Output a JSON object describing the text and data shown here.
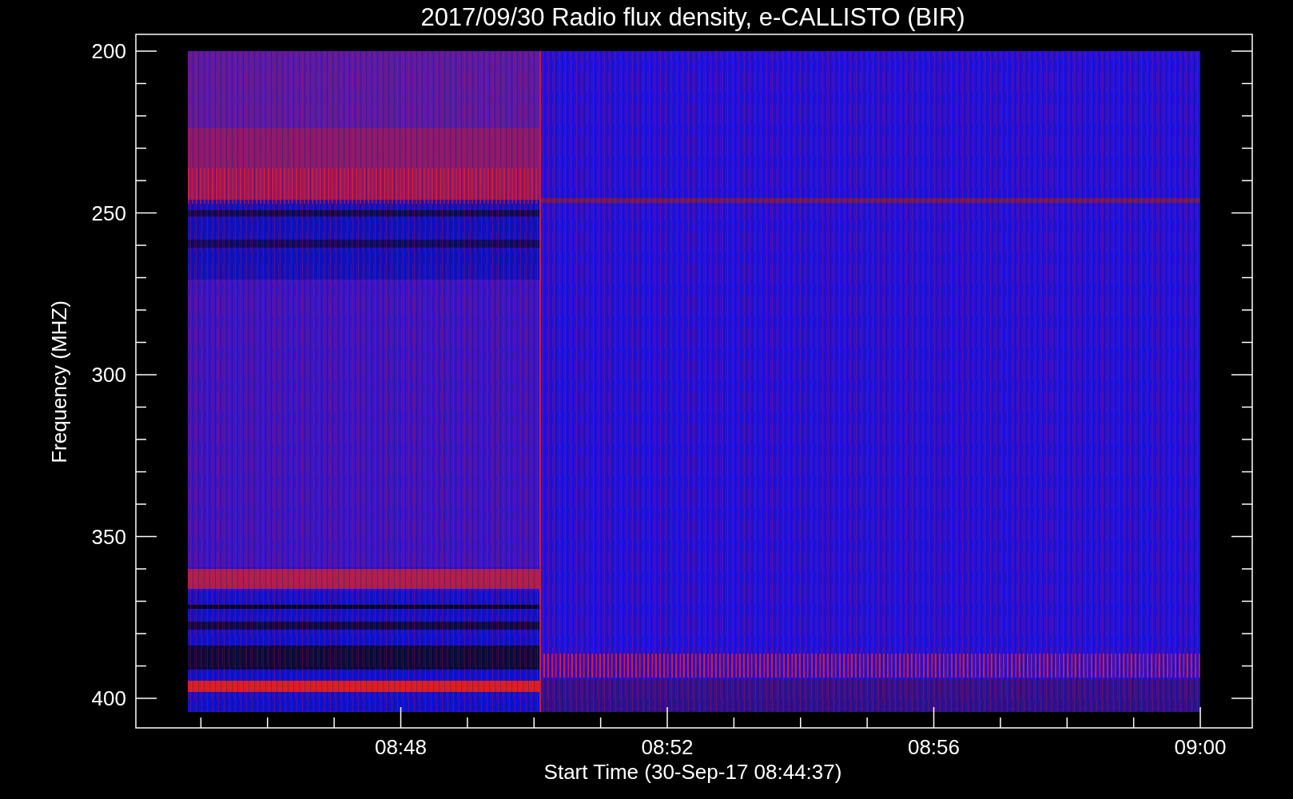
{
  "title": "2017/09/30  Radio flux density, e-CALLISTO (BIR)",
  "y_axis": {
    "label": "Frequency (MHZ)",
    "ticks": [
      "200",
      "250",
      "300",
      "350",
      "400"
    ]
  },
  "x_axis": {
    "label": "Start Time (30-Sep-17 08:44:37)",
    "ticks": [
      "08:48",
      "08:52",
      "08:56",
      "09:00"
    ]
  }
}
